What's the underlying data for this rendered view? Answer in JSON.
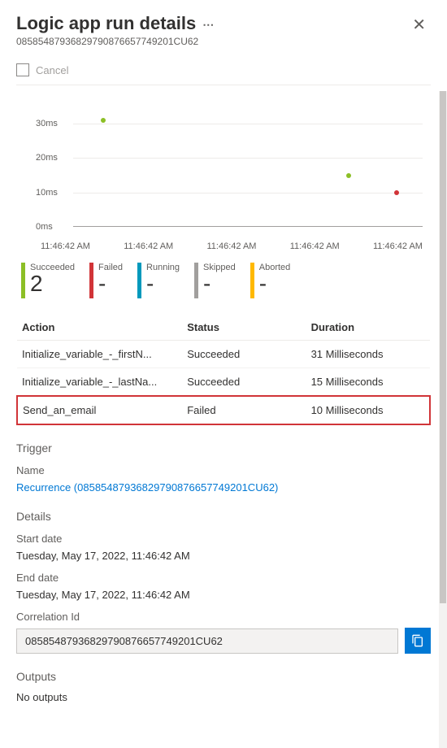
{
  "header": {
    "title": "Logic app run details",
    "run_id": "08585487936829790876657749201CU62"
  },
  "toolbar": {
    "cancel_label": "Cancel"
  },
  "chart_data": {
    "type": "scatter",
    "y_ticks": [
      "30ms",
      "20ms",
      "10ms",
      "0ms"
    ],
    "x_tick": "11:46:42 AM",
    "x_count": 5,
    "series": [
      {
        "name": "Succeeded",
        "color": "#8cbf26",
        "points": [
          {
            "x": 0.08,
            "ms": 31
          },
          {
            "x": 0.8,
            "ms": 15
          }
        ]
      },
      {
        "name": "Failed",
        "color": "#d13438",
        "points": [
          {
            "x": 0.94,
            "ms": 10
          }
        ]
      }
    ],
    "ylim": [
      0,
      35
    ]
  },
  "tiles": [
    {
      "label": "Succeeded",
      "value": "2",
      "color": "#8cbf26"
    },
    {
      "label": "Failed",
      "value": "-",
      "color": "#d13438"
    },
    {
      "label": "Running",
      "value": "-",
      "color": "#0099bc"
    },
    {
      "label": "Skipped",
      "value": "-",
      "color": "#a19f9d"
    },
    {
      "label": "Aborted",
      "value": "-",
      "color": "#ffb900"
    }
  ],
  "table": {
    "headers": {
      "action": "Action",
      "status": "Status",
      "duration": "Duration"
    },
    "rows": [
      {
        "action": "Initialize_variable_-_firstN...",
        "status": "Succeeded",
        "duration": "31 Milliseconds",
        "highlight": false
      },
      {
        "action": "Initialize_variable_-_lastNa...",
        "status": "Succeeded",
        "duration": "15 Milliseconds",
        "highlight": false
      },
      {
        "action": "Send_an_email",
        "status": "Failed",
        "duration": "10 Milliseconds",
        "highlight": true
      }
    ]
  },
  "trigger": {
    "section": "Trigger",
    "name_label": "Name",
    "link_text": "Recurrence (08585487936829790876657749201CU62)"
  },
  "details": {
    "section": "Details",
    "start_label": "Start date",
    "start_value": "Tuesday, May 17, 2022, 11:46:42 AM",
    "end_label": "End date",
    "end_value": "Tuesday, May 17, 2022, 11:46:42 AM",
    "corr_label": "Correlation Id",
    "corr_value": "08585487936829790876657749201CU62"
  },
  "outputs": {
    "section": "Outputs",
    "value": "No outputs"
  }
}
